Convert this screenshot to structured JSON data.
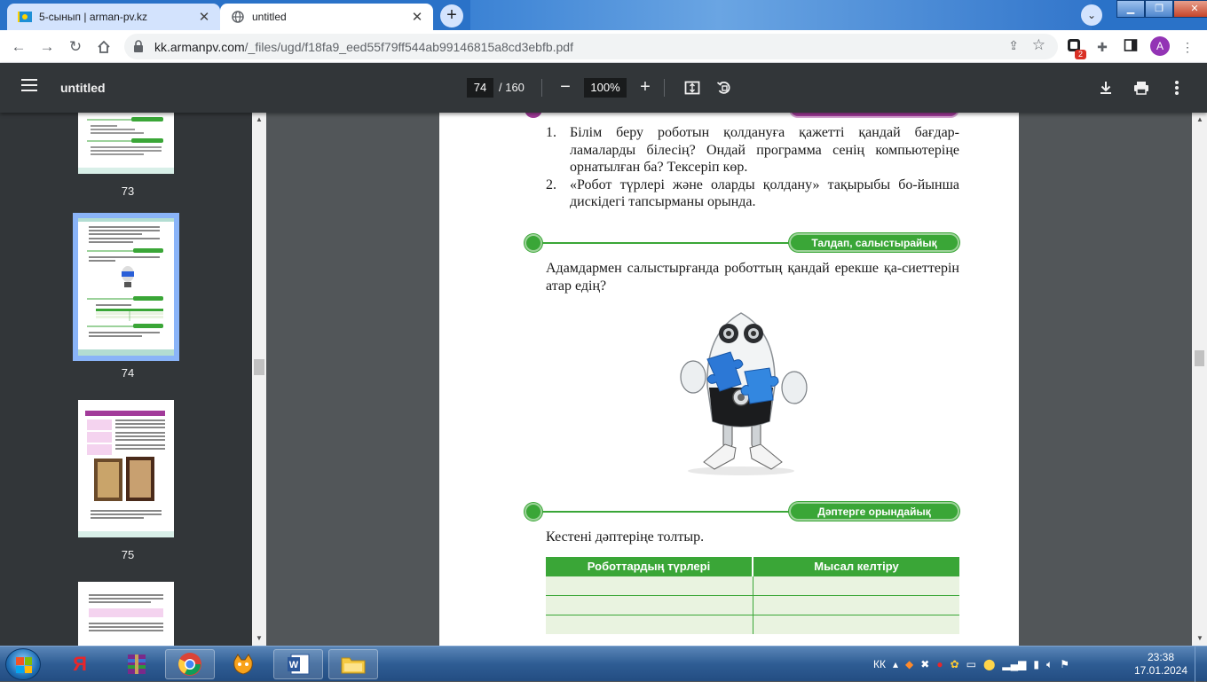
{
  "browser": {
    "tabs": [
      {
        "title": "5-сынып | arman-pv.kz",
        "active": false
      },
      {
        "title": "untitled",
        "active": true
      }
    ],
    "new_tab": "+",
    "address": {
      "domain": "kk.armanpv.com",
      "path": "/_files/ugd/f18fa9_eed55f79ff544ab99146815a8cd3ebfb.pdf"
    },
    "extension_badge": "2",
    "profile_initial": "A",
    "colors": {
      "tab_strip": "#2a72c8",
      "avatar": "#9334b5"
    }
  },
  "pdf_viewer": {
    "title": "untitled",
    "current_page": "74",
    "total_pages": "/ 160",
    "zoom": "100%"
  },
  "thumbnails": [
    {
      "page": "73",
      "selected": false
    },
    {
      "page": "74",
      "selected": true
    },
    {
      "page": "75",
      "selected": false
    }
  ],
  "document": {
    "questions": [
      {
        "num": "1.",
        "text": "Білім беру роботын қолдануға қажетті қандай бағдар-ламаларды білесің? Ондай программа сенің компьютеріңе орнатылған ба? Тексеріп көр."
      },
      {
        "num": "2.",
        "text": "«Робот түрлері және оларды қолдану»  тақырыбы бо-йынша дискідегі тапсырманы орында."
      }
    ],
    "section_analyze": {
      "label": "Талдап, салыстырайық"
    },
    "analyze_text": "Адамдармен салыстырғанда роботтың қандай ерекше қа-сиеттерін атар едің?",
    "section_notebook": {
      "label": "Дәптерге орындайық"
    },
    "notebook_text": "Кестені дәптеріңе толтыр.",
    "table": {
      "headers": [
        "Роботтардың түрлері",
        "Мысал келтіру"
      ],
      "rows": [
        [
          "",
          ""
        ],
        [
          "",
          ""
        ],
        [
          "",
          ""
        ]
      ]
    },
    "colors": {
      "accent_green": "#3aa637",
      "accent_purple": "#a23b9a",
      "table_fill": "#e9f3e0"
    }
  },
  "taskbar": {
    "language": "КК",
    "time": "23:38",
    "date": "17.01.2024",
    "apps": [
      "yandex-browser",
      "winrar",
      "chrome",
      "scratch",
      "word",
      "file-explorer"
    ]
  }
}
